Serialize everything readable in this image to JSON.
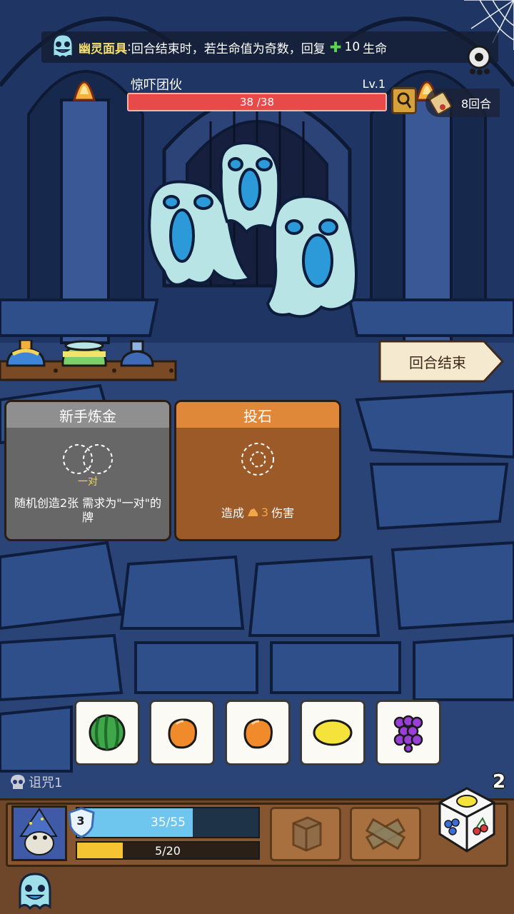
{
  "relic": {
    "name": "幽灵面具",
    "sep": ":",
    "description": "回合结束时，若生命值为奇数，回复",
    "heal_symbol": "✚",
    "heal_amount": "10",
    "heal_unit": "生命",
    "icon": "ghost-mask-icon"
  },
  "enemy": {
    "name": "惊吓团伙",
    "level": "Lv.1",
    "hp_text": "38 /38",
    "hp_fraction": 1.0,
    "intent_icon": "magnifier-icon"
  },
  "round": {
    "text": "8回合",
    "icon": "scroll-icon"
  },
  "end_turn": {
    "label": "回合结束"
  },
  "cards": [
    {
      "title": "新手炼金",
      "slot_label": "一对",
      "description": "随机创造2张 需求为\"一对\"的牌",
      "style": "gray"
    },
    {
      "title": "投石",
      "desc_prefix": "造成",
      "damage": "3",
      "desc_suffix": "伤害",
      "style": "orange"
    }
  ],
  "dice": [
    {
      "fruit": "watermelon",
      "color": "#3fa64a"
    },
    {
      "fruit": "orange",
      "color": "#f08a2a"
    },
    {
      "fruit": "orange",
      "color": "#f08a2a"
    },
    {
      "fruit": "lemon",
      "color": "#f5e23a"
    },
    {
      "fruit": "grape",
      "color": "#9a3ed8"
    }
  ],
  "curse": {
    "label": "诅咒1",
    "icon": "skull-icon"
  },
  "reroll": {
    "count": "2"
  },
  "player": {
    "shield": "3",
    "hp_text": "35/55",
    "hp_fraction": 0.636,
    "xp_text": "5/20",
    "xp_fraction": 0.25
  },
  "colors": {
    "hp_red": "#e84a4a",
    "player_hp": "#6ec5ee",
    "xp_yellow": "#f4c432",
    "card_orange": "#e0883a",
    "card_gray": "#8f8f8f"
  }
}
